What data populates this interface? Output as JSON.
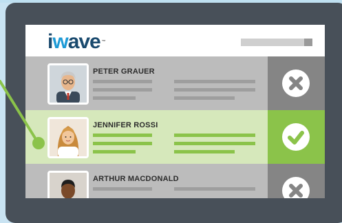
{
  "app": {
    "logo_text_part1": "i",
    "logo_text_part2": "w",
    "logo_text_part3": "ave",
    "logo_tm": "™"
  },
  "candidates": [
    {
      "name": "PETER GRAUER",
      "status": "rejected",
      "status_icon": "close-icon"
    },
    {
      "name": "JENNIFER ROSSI",
      "status": "selected",
      "status_icon": "check-icon"
    },
    {
      "name": "ARTHUR MACDONALD",
      "status": "rejected",
      "status_icon": "close-icon"
    }
  ],
  "colors": {
    "accent_green": "#8bc34a",
    "selected_row": "#d6e8bb",
    "rejected_row": "#bcbcbc",
    "rejected_action": "#858585",
    "frame": "#485059",
    "background": "#c9e3f2"
  }
}
